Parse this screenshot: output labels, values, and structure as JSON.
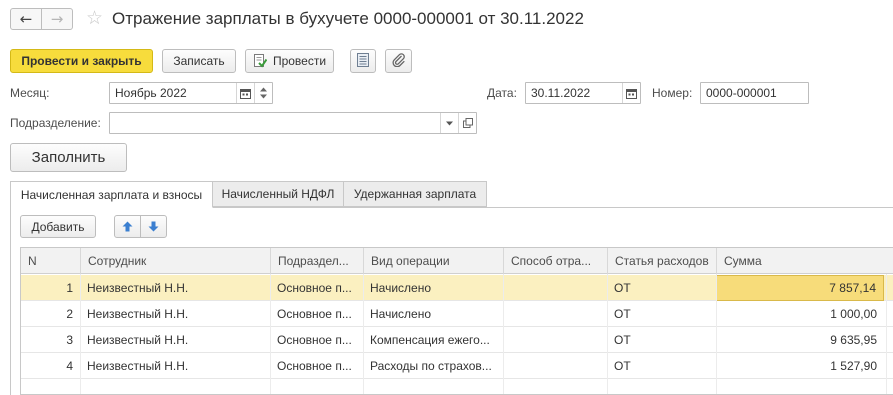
{
  "window": {
    "title": "Отражение зарплаты в бухучете 0000-000001 от 30.11.2022",
    "back_icon": "←",
    "forward_icon": "→",
    "star_icon": "☆"
  },
  "toolbar": {
    "post_close_label": "Провести и закрыть",
    "save_label": "Записать",
    "post_label": "Провести"
  },
  "form": {
    "month_label": "Месяц:",
    "month_value": "Ноябрь 2022",
    "date_label": "Дата:",
    "date_value": "30.11.2022",
    "number_label": "Номер:",
    "number_value": "0000-000001",
    "department_label": "Подразделение:",
    "department_value": "",
    "fill_button": "Заполнить"
  },
  "tabs": [
    {
      "label": "Начисленная зарплата и взносы",
      "active": true
    },
    {
      "label": "Начисленный НДФЛ",
      "active": false
    },
    {
      "label": "Удержанная зарплата",
      "active": false
    }
  ],
  "table_toolbar": {
    "add_label": "Добавить"
  },
  "table": {
    "columns": [
      "N",
      "Сотрудник",
      "Подраздел...",
      "Вид операции",
      "Способ отра...",
      "Статья расходов",
      "Сумма"
    ],
    "rows": [
      {
        "n": "1",
        "employee": "Неизвестный Н.Н.",
        "dept": "Основное п...",
        "operation": "Начислено",
        "method": "",
        "expense": "ОТ",
        "sum": "7 857,14"
      },
      {
        "n": "2",
        "employee": "Неизвестный Н.Н.",
        "dept": "Основное п...",
        "operation": "Начислено",
        "method": "",
        "expense": "ОТ",
        "sum": "1 000,00"
      },
      {
        "n": "3",
        "employee": "Неизвестный Н.Н.",
        "dept": "Основное п...",
        "operation": "Компенсация ежего...",
        "method": "",
        "expense": "ОТ",
        "sum": "9 635,95"
      },
      {
        "n": "4",
        "employee": "Неизвестный Н.Н.",
        "dept": "Основное п...",
        "operation": "Расходы по страхов...",
        "method": "",
        "expense": "ОТ",
        "sum": "1 527,90"
      }
    ]
  }
}
